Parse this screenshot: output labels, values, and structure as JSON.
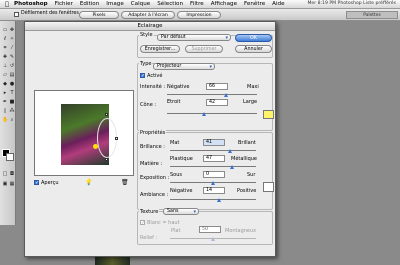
{
  "menubar": {
    "apple": "",
    "items": [
      "Photoshop",
      "Fichier",
      "Edition",
      "Image",
      "Calque",
      "Sélection",
      "Filtre",
      "Affichage",
      "Fenêtre",
      "Aide"
    ],
    "status": "Mer 8:19 PM  Photoshop  Liste préfférés"
  },
  "options": {
    "checkbox_label": "Défilement des fenêtres",
    "buttons": [
      "Pixels",
      "Adapter à l'écran",
      "Impression"
    ],
    "palette_tab": "Palettes"
  },
  "dialog": {
    "title": "Eclairage",
    "style": {
      "label": "Style",
      "value": "Par défaut"
    },
    "ok": "OK",
    "annuler": "Annuler",
    "enregistrer": "Enregistrer...",
    "supprimer": "Supprimer",
    "type": {
      "label": "Type",
      "value": "Projecteur"
    },
    "active": "Activé",
    "intensite": {
      "label": "Intensité :",
      "min": "Négative",
      "max": "Maxi",
      "value": "66",
      "fraction": 0.66
    },
    "cone": {
      "label": "Cône :",
      "min": "Etroit",
      "max": "Large",
      "value": "42",
      "fraction": 0.42
    },
    "proprietes": "Propriétés",
    "brillance": {
      "label": "Brillance :",
      "min": "Mat",
      "max": "Brillant",
      "value": "41",
      "fraction": 0.7
    },
    "matiere": {
      "label": "Matière :",
      "min": "Plastique",
      "max": "Métallique",
      "value": "47",
      "fraction": 0.73
    },
    "exposition": {
      "label": "Exposition :",
      "min": "Sous",
      "max": "Sur",
      "value": "0",
      "fraction": 0.5
    },
    "ambiance": {
      "label": "Ambiance :",
      "min": "Négative",
      "max": "Positive",
      "value": "14",
      "fraction": 0.57
    },
    "texture": {
      "label": "Texture",
      "value": "Sans"
    },
    "blanc_haut": "Blanc = haut",
    "relief": {
      "label": "Relief :",
      "min": "Plat",
      "max": "Montagneux",
      "value": "50",
      "fraction": 0.5
    },
    "apercu": "Aperçu",
    "colors": {
      "light": "#fff36a",
      "material": "#ffffff"
    }
  }
}
